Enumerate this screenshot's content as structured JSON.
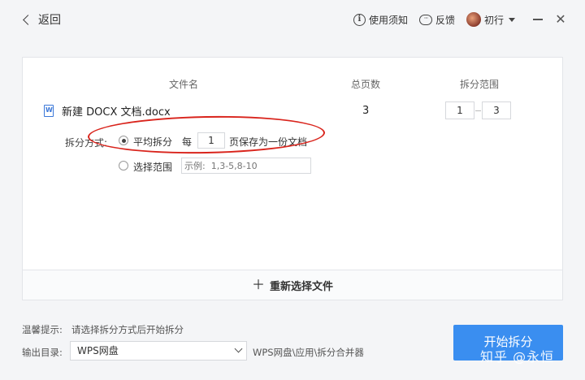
{
  "titlebar": {
    "back_label": "返回",
    "notice_label": "使用须知",
    "feedback_label": "反馈",
    "user_name": "初行"
  },
  "table": {
    "col_filename": "文件名",
    "col_pages": "总页数",
    "col_range": "拆分范围",
    "file": {
      "name": "新建 DOCX 文档.docx",
      "pages": "3",
      "range_from": "1",
      "range_to": "3"
    }
  },
  "split": {
    "mode_label": "拆分方式:",
    "option_even": "平均拆分",
    "option_even_selected": true,
    "every_label": "每",
    "every_value": "1",
    "save_suffix": "页保存为一份文档",
    "option_range": "选择范围",
    "range_placeholder": "示例:  1,3-5,8-10"
  },
  "reselect_label": "重新选择文件",
  "footer": {
    "tip_label": "温馨提示:",
    "tip_text": "请选择拆分方式后开始拆分",
    "output_label": "输出目录:",
    "output_value": "WPS网盘",
    "output_path": "WPS网盘\\应用\\拆分合并器",
    "start_label": "开始拆分",
    "watermark": "知乎 @永恒"
  },
  "colors": {
    "primary": "#3a8ef0",
    "annotation_red": "#d9241c",
    "doc_icon_blue": "#3a77d8"
  },
  "icons": {
    "back": "chevron-left-icon",
    "notice": "info-circle-icon",
    "feedback": "chat-bubble-icon",
    "user": "avatar",
    "minimize": "minimize-icon",
    "close": "close-icon",
    "file": "word-doc-icon",
    "add": "plus-icon"
  }
}
